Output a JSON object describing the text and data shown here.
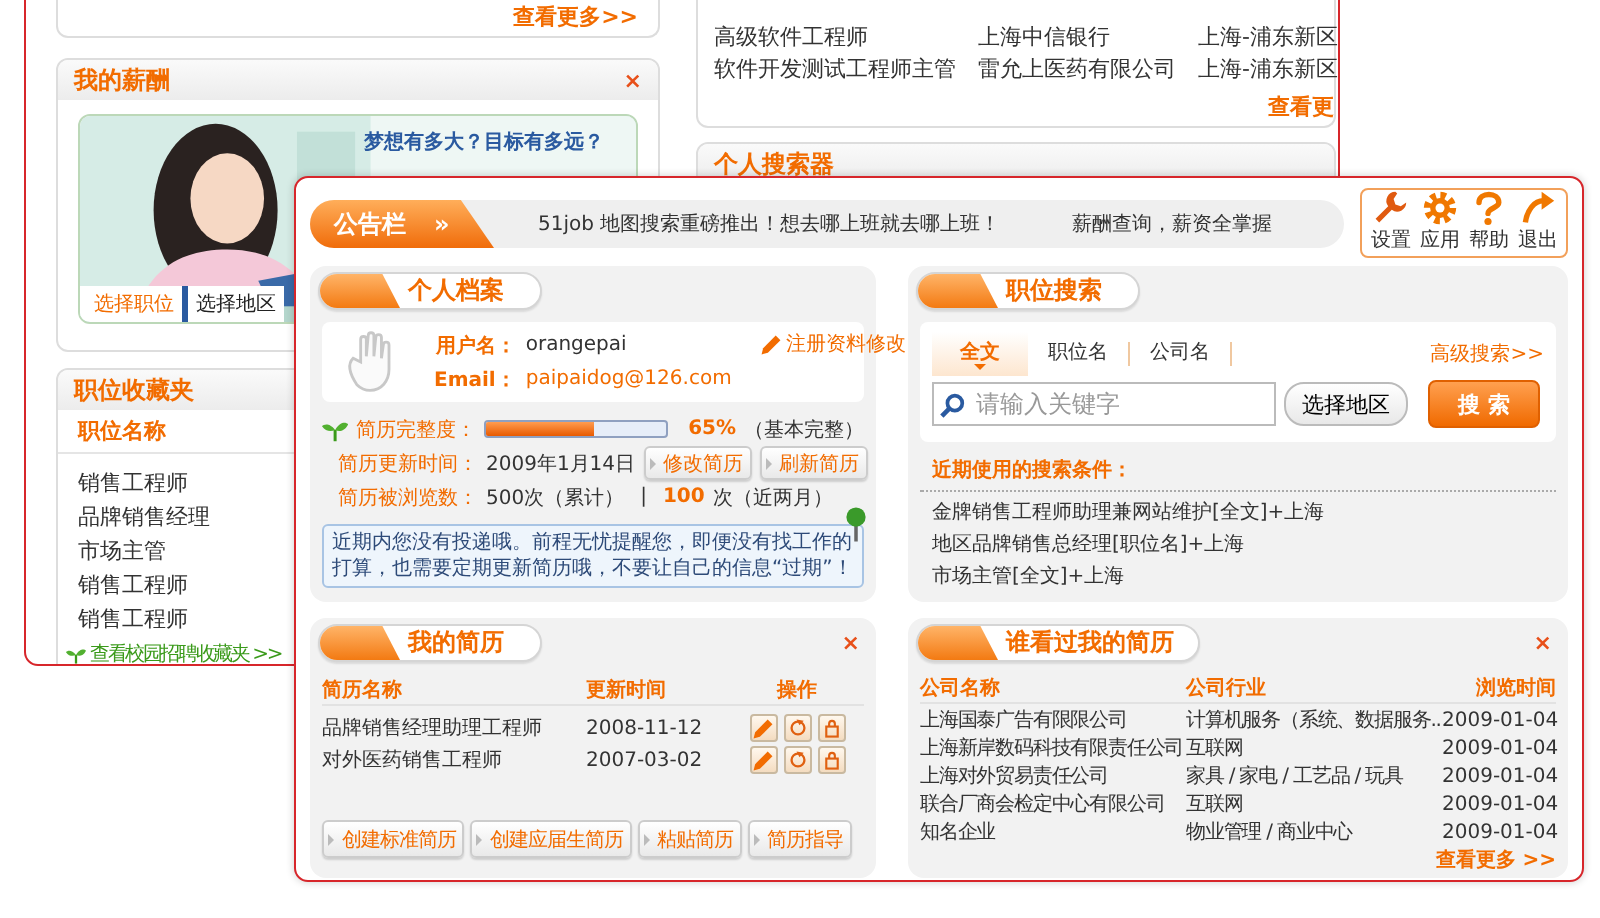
{
  "back_window": {
    "top_card": {
      "more_link": "查看更多>>"
    },
    "salary_card": {
      "title": "我的薪酬",
      "close": "×",
      "slogan": "梦想有多大？目标有多远？",
      "tabs": [
        {
          "label": "选择职位",
          "selected": true
        },
        {
          "label": "选择地区",
          "selected": false
        }
      ]
    },
    "favorites_card": {
      "title": "职位收藏夹",
      "column": "职位名称",
      "items": [
        "销售工程师",
        "品牌销售经理",
        "市场主管",
        "销售工程师",
        "销售工程师"
      ],
      "link": "查看校园招聘收藏夹 >>"
    },
    "jobs_card": {
      "rows": [
        {
          "position": "高级软件工程师",
          "company": "上海中信银行",
          "location": "上海-浦东新区"
        },
        {
          "position": "软件开发测试工程师主管",
          "company": "雷允上医药有限公司",
          "location": "上海-浦东新区"
        }
      ],
      "more_link": "查看更"
    },
    "searcher_card": {
      "title": "个人搜索器"
    }
  },
  "front_window": {
    "notice": {
      "label": "公告栏",
      "arrow": "»",
      "messages": [
        "51job 地图搜索重磅推出！想去哪上班就去哪上班！",
        "薪酬查询，薪资全掌握"
      ]
    },
    "toolbar": [
      {
        "kind": "settings",
        "label": "设置"
      },
      {
        "kind": "apps",
        "label": "应用"
      },
      {
        "kind": "help",
        "label": "帮助"
      },
      {
        "kind": "logout",
        "label": "退出"
      }
    ],
    "profile": {
      "title": "个人档案",
      "username_label": "用户名：",
      "username": "orangepai",
      "email_label": "Email：",
      "email": "paipaidog@126.com",
      "edit_link": "注册资料修改",
      "completeness_label": "简历完整度：",
      "completeness": {
        "level": 0.6
      },
      "completeness_value": "65%",
      "completeness_note": "（基本完整）",
      "updated_label": "简历更新时间：",
      "updated": "2009年1月14日",
      "buttons": [
        "修改简历",
        "刷新简历"
      ],
      "views_label": "简历被浏览数：",
      "views_total": "500次（累计）",
      "separator": "|",
      "views_recent_count": "100",
      "views_recent_note": "次（近两月）",
      "tip": "近期内您没有投递哦。前程无忧提醒您，即便没有找工作的打算，也需要定期更新简历哦，不要让自己的信息“过期”！"
    },
    "resumes": {
      "title": "我的简历",
      "close": "×",
      "columns": [
        "简历名称",
        "更新时间",
        "操作"
      ],
      "rows": [
        {
          "name": "品牌销售经理助理工程师",
          "updated": "2008-11-12"
        },
        {
          "name": "对外医药销售工程师",
          "updated": "2007-03-02"
        }
      ],
      "buttons": [
        "创建标准简历",
        "创建应届生简历",
        "粘贴简历",
        "简历指导"
      ]
    },
    "search": {
      "title": "职位搜索",
      "tabs": [
        {
          "label": "全文",
          "selected": true
        },
        {
          "label": "职位名",
          "selected": false
        },
        {
          "label": "公司名",
          "selected": false
        }
      ],
      "advanced_link": "高级搜索>>",
      "placeholder": "请输入关键字",
      "area_button": "选择地区",
      "search_button": "搜 索",
      "recent_label": "近期使用的搜索条件：",
      "recent": [
        "金牌销售工程师助理兼网站维护[全文]+上海",
        "地区品牌销售总经理[职位名]+上海",
        "市场主管[全文]+上海"
      ]
    },
    "viewers": {
      "title": "谁看过我的简历",
      "close": "×",
      "columns": [
        "公司名称",
        "公司行业",
        "浏览时间"
      ],
      "rows": [
        {
          "company": "上海国泰广告有限限公司",
          "industry": "计算机服务（系统、数据服务..",
          "time": "2009-01-04"
        },
        {
          "company": "上海新岸数码科技有限责任公司",
          "industry": "互联网",
          "time": "2009-01-04"
        },
        {
          "company": "上海对外贸易责任公司",
          "industry": "家具 / 家电 / 工艺品 / 玩具",
          "time": "2009-01-04"
        },
        {
          "company": "联合厂商会检定中心有限公司",
          "industry": "互联网",
          "time": "2009-01-04"
        },
        {
          "company": "知名企业",
          "industry": "物业管理 / 商业中心",
          "time": "2009-01-04"
        }
      ],
      "more_link": "查看更多 >>"
    }
  }
}
